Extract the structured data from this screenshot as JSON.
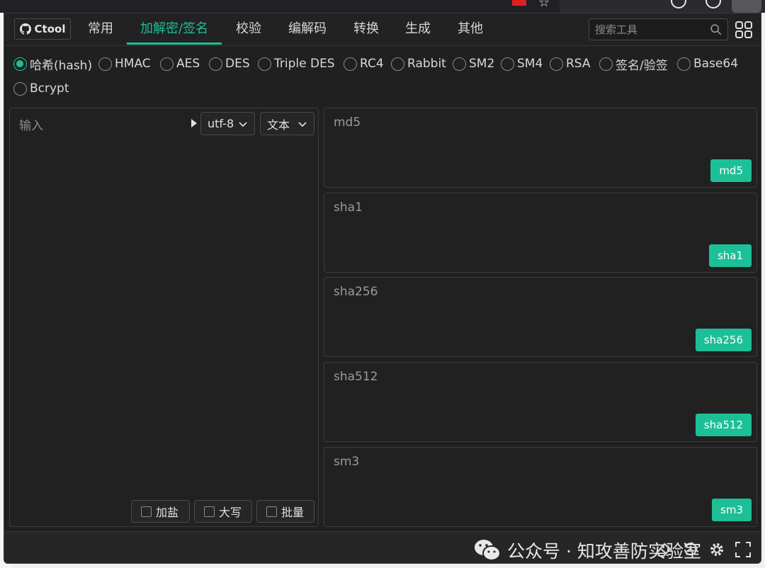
{
  "app": {
    "logo_label": "Ctool"
  },
  "nav": {
    "tabs": [
      {
        "label": "常用"
      },
      {
        "label": "加解密/签名"
      },
      {
        "label": "校验"
      },
      {
        "label": "编解码"
      },
      {
        "label": "转换"
      },
      {
        "label": "生成"
      },
      {
        "label": "其他"
      }
    ],
    "active_tab": "加解密/签名",
    "search_placeholder": "搜索工具"
  },
  "algorithms": {
    "options": [
      {
        "label": "哈希(hash)",
        "checked": true
      },
      {
        "label": "HMAC",
        "checked": false
      },
      {
        "label": "AES",
        "checked": false
      },
      {
        "label": "DES",
        "checked": false
      },
      {
        "label": "Triple DES",
        "checked": false
      },
      {
        "label": "RC4",
        "checked": false
      },
      {
        "label": "Rabbit",
        "checked": false
      },
      {
        "label": "SM2",
        "checked": false
      },
      {
        "label": "SM4",
        "checked": false
      },
      {
        "label": "RSA",
        "checked": false
      },
      {
        "label": "签名/验签",
        "checked": false
      },
      {
        "label": "Base64",
        "checked": false
      },
      {
        "label": "Bcrypt",
        "checked": false
      }
    ]
  },
  "input": {
    "placeholder": "输入",
    "encoding": "utf-8",
    "type": "文本",
    "options": [
      {
        "label": "加盐"
      },
      {
        "label": "大写"
      },
      {
        "label": "批量"
      }
    ]
  },
  "outputs": [
    {
      "label": "md5",
      "button": "md5"
    },
    {
      "label": "sha1",
      "button": "sha1"
    },
    {
      "label": "sha256",
      "button": "sha256"
    },
    {
      "label": "sha512",
      "button": "sha512"
    },
    {
      "label": "sm3",
      "button": "sm3"
    }
  ],
  "footer": {
    "watermark": "公众号 · 知攻善防实验室"
  },
  "colors": {
    "accent": "#1dbf96",
    "background": "#202020"
  }
}
